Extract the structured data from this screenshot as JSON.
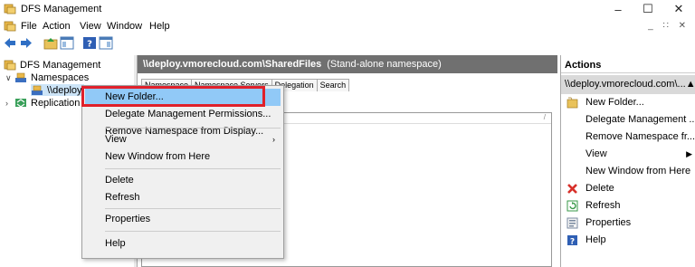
{
  "window": {
    "title": "DFS Management"
  },
  "menubar": {
    "items": [
      "File",
      "Action",
      "View",
      "Window",
      "Help"
    ]
  },
  "tree": {
    "root": "DFS Management",
    "namespaces": "Namespaces",
    "namespace_item": "\\\\deploy.",
    "replication": "Replication"
  },
  "center": {
    "path": "\\\\deploy.vmorecloud.com\\SharedFiles",
    "type": "(Stand-alone namespace)",
    "tabs": [
      "Namespace",
      "Namespace Servers",
      "Delegation",
      "Search"
    ]
  },
  "actions": {
    "title": "Actions",
    "subheader": "\\\\deploy.vmorecloud.com\\...",
    "items": [
      {
        "label": "New Folder...",
        "icon": "new-folder-icon"
      },
      {
        "label": "Delegate Management ...",
        "icon": ""
      },
      {
        "label": "Remove Namespace fr...",
        "icon": ""
      },
      {
        "label": "View",
        "icon": "",
        "submenu": true
      },
      {
        "label": "New Window from Here",
        "icon": ""
      },
      {
        "label": "Delete",
        "icon": "delete-x-icon"
      },
      {
        "label": "Refresh",
        "icon": "refresh-icon"
      },
      {
        "label": "Properties",
        "icon": "properties-icon"
      },
      {
        "label": "Help",
        "icon": "help-icon"
      }
    ]
  },
  "context_menu": {
    "items": [
      "New Folder...",
      "Delegate Management Permissions...",
      "Remove Namespace from Display...",
      "View",
      "New Window from Here",
      "Delete",
      "Refresh",
      "Properties",
      "Help"
    ],
    "highlighted": "New Folder..."
  },
  "colors": {
    "header_bar": "#707070",
    "highlight": "#91c9f7",
    "callout": "#e0202a",
    "actions_sub": "#d9d9d9"
  }
}
